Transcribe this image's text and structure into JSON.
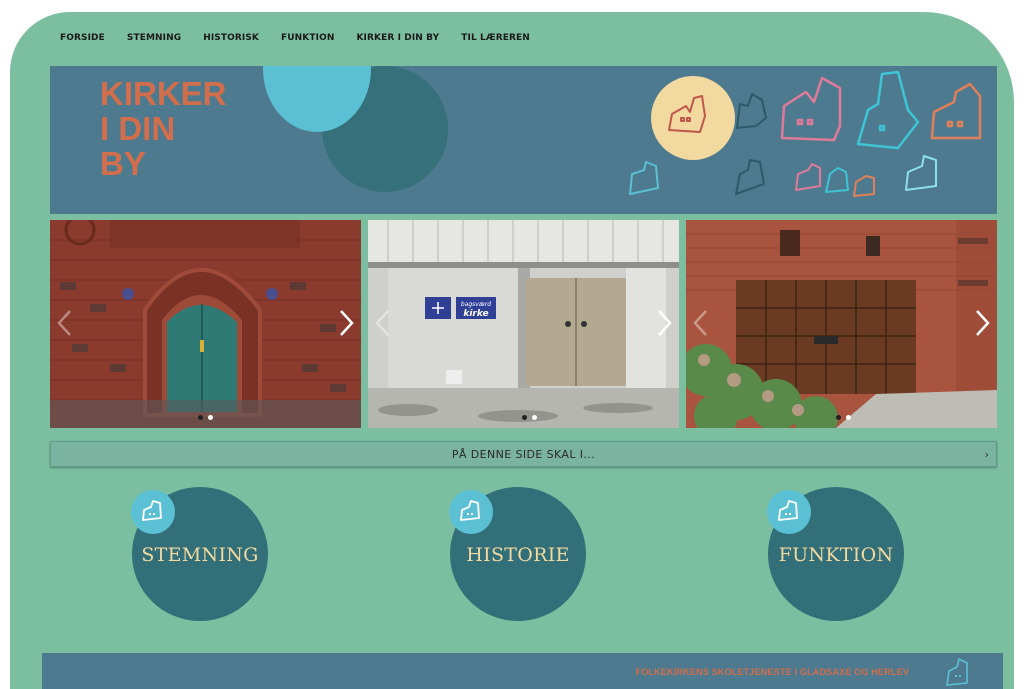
{
  "nav": {
    "items": [
      "FORSIDE",
      "STEMNING",
      "HISTORISK",
      "FUNKTION",
      "KIRKER I DIN BY",
      "TIL LÆREREN"
    ]
  },
  "banner": {
    "logo_lines": [
      "KIRKER",
      "I DIN",
      "BY"
    ]
  },
  "carousels": [
    {
      "description_icon": "church-door-green-icon",
      "dots": 2,
      "active_dot": 1
    },
    {
      "sign_text_1": "bagsværd",
      "sign_text_2": "kirke",
      "dots": 2,
      "active_dot": 0
    },
    {
      "description_icon": "brown-garage-door-icon",
      "dots": 2,
      "active_dot": 0
    }
  ],
  "accordion": {
    "label": "PÅ DENNE SIDE SKAL I...",
    "chevron": "›"
  },
  "sections": [
    {
      "label": "STEMNING"
    },
    {
      "label": "HISTORIE"
    },
    {
      "label": "FUNKTION"
    }
  ],
  "footer": {
    "text": "FOLKEKIRKENS SKOLETJENESTE I GLADSAXE OG HERLEV"
  },
  "colors": {
    "background": "#7cbfa0",
    "banner": "#4d7a8e",
    "logo": "#d26e4b",
    "circle": "#336f78",
    "accent_cyan": "#5cc0d4",
    "accent_yellow": "#f1d9a0"
  }
}
